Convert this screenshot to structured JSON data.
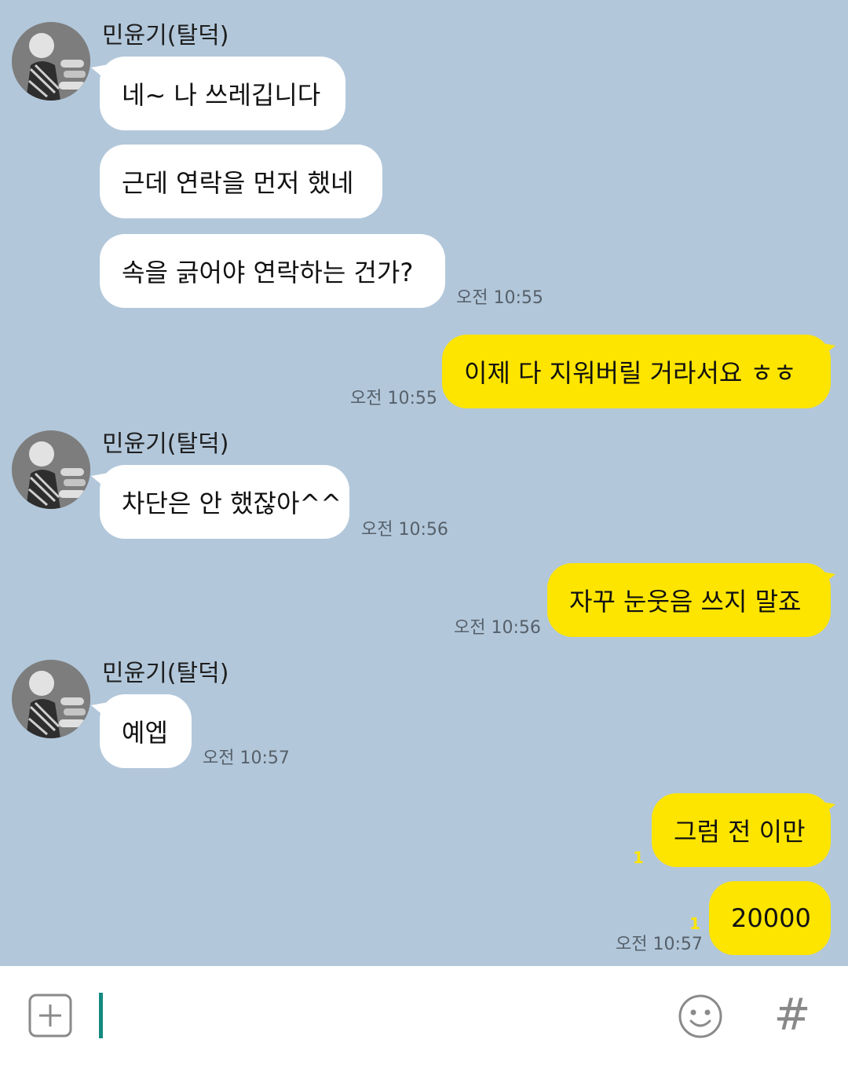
{
  "contact": {
    "name": "민윤기(탈덕)"
  },
  "messages": [
    {
      "text": "네~ 나 쓰레깁니다"
    },
    {
      "text": "근데 연락을 먼저 했네"
    },
    {
      "text": "속을 긁어야 연락하는 건가?",
      "time": "오전 10:55"
    },
    {
      "text": "이제 다 지워버릴 거라서요 ㅎㅎ",
      "time": "오전 10:55"
    },
    {
      "text": "차단은 안 했잖아^^",
      "time": "오전 10:56"
    },
    {
      "text": "자꾸 눈웃음 쓰지 말죠",
      "time": "오전 10:56"
    },
    {
      "text": "예엡",
      "time": "오전 10:57"
    },
    {
      "text": "그럼 전 이만",
      "unread": "1"
    },
    {
      "text": "20000",
      "unread": "1",
      "time": "오전 10:57"
    }
  ],
  "input": {
    "value": ""
  },
  "icons": {
    "attach": "plus-square-icon",
    "emoji": "emoji-icon",
    "hashtag": "hash-icon"
  },
  "colors": {
    "background": "#b2c7da",
    "incoming_bubble": "#ffffff",
    "outgoing_bubble": "#fee500",
    "cursor": "#138a80"
  }
}
